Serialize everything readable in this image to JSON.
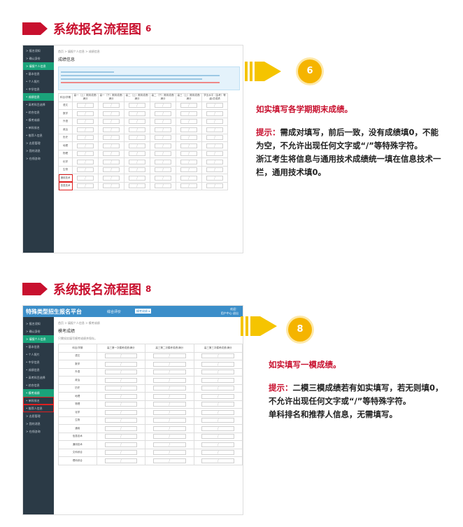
{
  "s1": {
    "heading": "系统报名流程图",
    "num": "6",
    "circle": "6",
    "crumb": "首页 > 填报个人信息 > 成绩信息",
    "page_title": "成绩信息",
    "sidebar": [
      {
        "label": "> 报名须知"
      },
      {
        "label": "> 确认身份"
      },
      {
        "label": "> 填报个人信息",
        "active": true
      },
      {
        "label": "• 基本信息"
      },
      {
        "label": "• 个人照片"
      },
      {
        "label": "• 中学信息"
      },
      {
        "label": "• 成绩信息",
        "active": true
      },
      {
        "label": "• 高考科目选择"
      },
      {
        "label": "• 综合信息"
      },
      {
        "label": "• 模考成绩"
      },
      {
        "label": "• 单科排名"
      },
      {
        "label": "• 推荐人信息"
      },
      {
        "label": "> 志愿管理"
      },
      {
        "label": "> 我的消息"
      },
      {
        "label": "> 在线咨询"
      }
    ],
    "columns": [
      "科目/学期",
      "高一（上）期末成绩/满分",
      "高一（下）期末成绩/满分",
      "高二（上）期末成绩/满分",
      "高二（下）期末成绩/满分",
      "高三（上）期末成绩/满分",
      "学业水平（会考）等级/总成绩"
    ],
    "subjects": [
      "语文",
      "数学",
      "外语",
      "政治",
      "历史",
      "地理",
      "物理",
      "化学",
      "生物",
      "通用技术",
      "信息技术"
    ],
    "cell_mark": "/",
    "lead": "如实填写各学期期末成绩。",
    "tip_label": "提示：",
    "tip": "需成对填写，前后一致，没有成绩填0，不能为空，不允许出现任何文字或“/”等特殊字符。",
    "tip2": "浙江考生将信息与通用技术成绩统一填在信息技术一栏，通用技术填0。"
  },
  "s2": {
    "heading": "系统报名流程图",
    "num": "8",
    "circle": "8",
    "brand": "特殊类型招生报名平台",
    "system": "综合评价",
    "badge": "模考成绩 ▾",
    "user": "欢迎：",
    "user2": "用户中心  退出",
    "crumb": "首页 > 填报个人信息 > 模考成绩",
    "page_title": "模考成绩",
    "hint": "只需如实填写模考成绩并保存。",
    "sidebar": [
      {
        "label": "> 报名须知"
      },
      {
        "label": "> 确认身份"
      },
      {
        "label": "> 填报个人信息",
        "active": true
      },
      {
        "label": "• 基本信息"
      },
      {
        "label": "• 个人照片"
      },
      {
        "label": "• 中学信息"
      },
      {
        "label": "• 成绩信息"
      },
      {
        "label": "• 高考科目选择"
      },
      {
        "label": "• 综合信息"
      },
      {
        "label": "• 模考成绩",
        "active": true
      },
      {
        "label": "• 单科排名",
        "hl": true
      },
      {
        "label": "• 推荐人信息",
        "hl": true
      },
      {
        "label": "> 志愿管理"
      },
      {
        "label": "> 我的消息"
      },
      {
        "label": "> 在线咨询"
      }
    ],
    "columns": [
      "科目/学期",
      "高三第一次模考成绩/满分",
      "高三第二次模考成绩/满分",
      "高三第三次模考成绩/满分"
    ],
    "subjects": [
      "语文",
      "数学",
      "外语",
      "政治",
      "历史",
      "地理",
      "物理",
      "化学",
      "生物",
      "通用",
      "信息技术",
      "通用技术",
      "文科综合",
      "理科综合"
    ],
    "cell_mark": "/",
    "lead": "如实填写一模成绩。",
    "tip_label": "提示：",
    "tip": "二模三模成绩若有如实填写，若无则填0，不允许出现任何文字或“/”等特殊字符。",
    "tip2": "单科排名和推荐人信息，无需填写。"
  }
}
